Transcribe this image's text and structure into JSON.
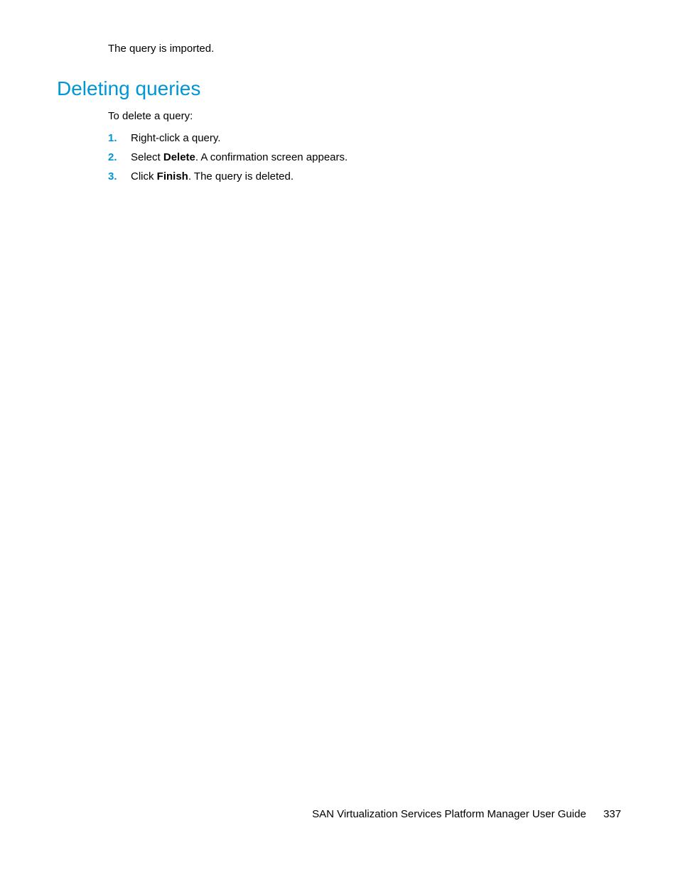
{
  "intro": "The query is imported.",
  "heading": "Deleting queries",
  "subtext": "To delete a query:",
  "steps": [
    {
      "num": "1.",
      "text": "Right-click a query."
    },
    {
      "num": "2.",
      "prefix": "Select ",
      "bold": "Delete",
      "suffix": ". A confirmation screen appears."
    },
    {
      "num": "3.",
      "prefix": "Click ",
      "bold": "Finish",
      "suffix": ". The query is deleted."
    }
  ],
  "footer": {
    "title": "SAN Virtualization Services Platform Manager User Guide",
    "page": "337"
  }
}
